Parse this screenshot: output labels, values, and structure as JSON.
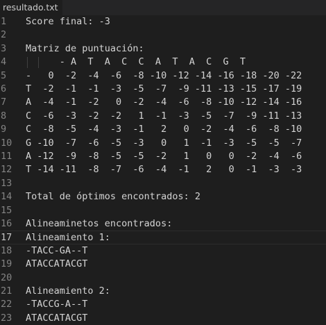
{
  "tab": {
    "title": "resultado.txt"
  },
  "current_line": 17,
  "lines": [
    {
      "n": "1",
      "text": "Score final: -3"
    },
    {
      "n": "2",
      "text": ""
    },
    {
      "n": "3",
      "text": "Matriz de puntuación:"
    },
    {
      "n": "4",
      "text": "      - A  T  A  C  C  A  T  A  C  G  T"
    },
    {
      "n": "5",
      "text": "-   0  -2  -4  -6  -8 -10 -12 -14 -16 -18 -20 -22"
    },
    {
      "n": "6",
      "text": "T  -2  -1  -1  -3  -5  -7  -9 -11 -13 -15 -17 -19"
    },
    {
      "n": "7",
      "text": "A  -4  -1  -2   0  -2  -4  -6  -8 -10 -12 -14 -16"
    },
    {
      "n": "8",
      "text": "C  -6  -3  -2  -2   1  -1  -3  -5  -7  -9 -11 -13"
    },
    {
      "n": "9",
      "text": "C  -8  -5  -4  -3  -1   2   0  -2  -4  -6  -8 -10"
    },
    {
      "n": "10",
      "text": "G -10  -7  -6  -5  -3   0   1  -1  -3  -5  -5  -7"
    },
    {
      "n": "11",
      "text": "A -12  -9  -8  -5  -5  -2   1   0   0  -2  -4  -6"
    },
    {
      "n": "12",
      "text": "T -14 -11  -8  -7  -6  -4  -1   2   0  -1  -3  -3"
    },
    {
      "n": "13",
      "text": ""
    },
    {
      "n": "14",
      "text": "Total de óptimos encontrados: 2"
    },
    {
      "n": "15",
      "text": ""
    },
    {
      "n": "16",
      "text": "Alineaminetos encontrados:"
    },
    {
      "n": "17",
      "text": "Alineamiento 1:"
    },
    {
      "n": "18",
      "text": "-TACC-GA--T"
    },
    {
      "n": "19",
      "text": "ATACCATACGT"
    },
    {
      "n": "20",
      "text": ""
    },
    {
      "n": "21",
      "text": "Alineamiento 2:"
    },
    {
      "n": "22",
      "text": "-TACCG-A--T"
    },
    {
      "n": "23",
      "text": "ATACCATACGT"
    }
  ]
}
